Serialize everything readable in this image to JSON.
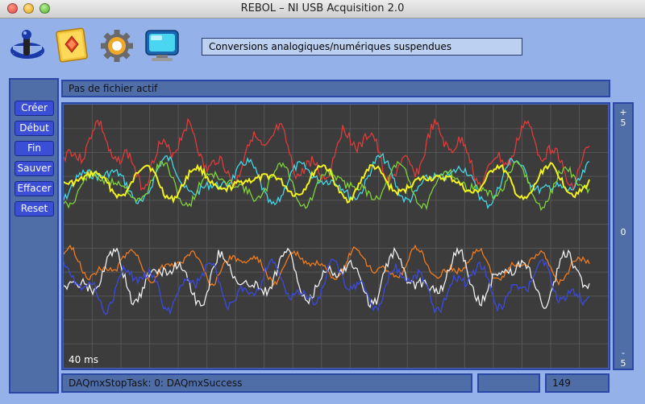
{
  "window": {
    "title": "REBOL – NI USB Acquisition 2.0"
  },
  "toolbar": {
    "icons": [
      "joystick-icon",
      "open-file-icon",
      "settings-gear-icon",
      "monitor-icon"
    ]
  },
  "status": {
    "message": "Conversions analogiques/numériques suspendues"
  },
  "file": {
    "label": "Pas de fichier actif"
  },
  "buttons": {
    "create": "Créer",
    "start": "Début",
    "end": "Fin",
    "save": "Sauver",
    "clear": "Effacer",
    "reset": "Reset"
  },
  "plot": {
    "time_label": "40 ms",
    "scale": {
      "top_sign": "+",
      "top_value": "5",
      "mid": "0",
      "bottom_sign": "-",
      "bottom_value": "5"
    },
    "background": "#3c3c3c",
    "grid_color": "#555555",
    "channels": [
      {
        "color": "#e03a3a"
      },
      {
        "color": "#44d6e8"
      },
      {
        "color": "#7fd23a"
      },
      {
        "color": "#f2f21e"
      },
      {
        "color": "#f07a1e"
      },
      {
        "color": "#f0f0f0"
      },
      {
        "color": "#3a4ae0"
      }
    ]
  },
  "footer": {
    "daq_status": "DAQmxStopTask: 0: DAQmxSuccess",
    "field2": "",
    "count": "149"
  }
}
